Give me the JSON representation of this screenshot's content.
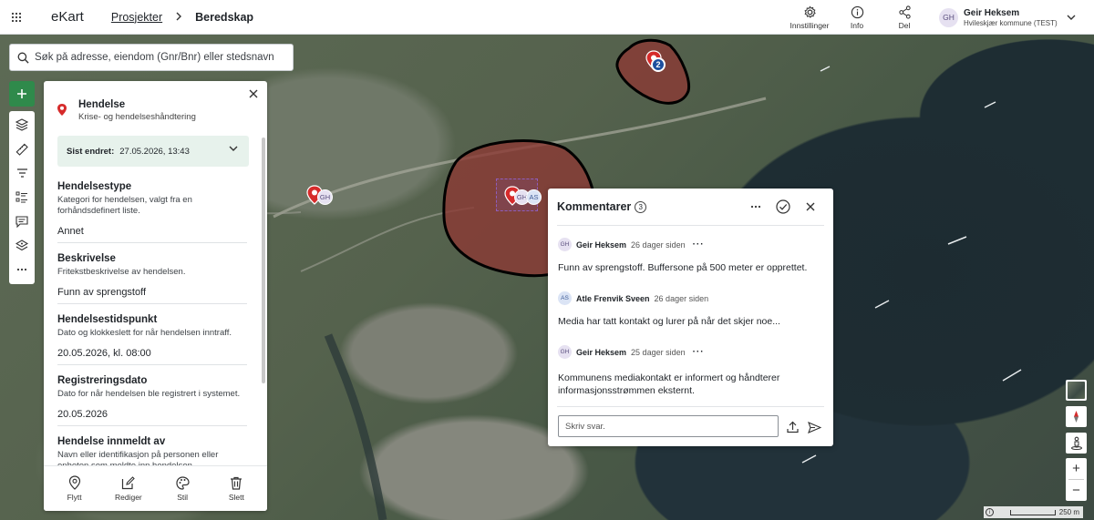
{
  "app": {
    "name": "eKart"
  },
  "breadcrumb": {
    "parent": "Prosjekter",
    "current": "Beredskap"
  },
  "header_actions": [
    {
      "label": "Innstillinger",
      "icon": "gear-icon"
    },
    {
      "label": "Info",
      "icon": "info-icon"
    },
    {
      "label": "Del",
      "icon": "share-icon"
    }
  ],
  "user": {
    "initials": "GH",
    "name": "Geir Heksem",
    "org": "Hvileskjær kommune (TEST)"
  },
  "search": {
    "placeholder": "Søk på adresse, eiendom (Gnr/Bnr) eller stedsnavn",
    "value": ""
  },
  "panel": {
    "title": "Hendelse",
    "subtitle": "Krise- og hendelseshåndtering",
    "last_changed_label": "Sist endret:",
    "last_changed_value": "27.05.2026, 13:43",
    "fields": [
      {
        "title": "Hendelsestype",
        "desc": "Kategori for hendelsen, valgt fra en forhåndsdefinert liste.",
        "value": "Annet"
      },
      {
        "title": "Beskrivelse",
        "desc": "Fritekstbeskrivelse av hendelsen.",
        "value": "Funn av sprengstoff"
      },
      {
        "title": "Hendelsestidspunkt",
        "desc": "Dato og klokkeslett for når hendelsen inntraff.",
        "value": "20.05.2026, kl. 08:00"
      },
      {
        "title": "Registreringsdato",
        "desc": "Dato for når hendelsen ble registrert i systemet.",
        "value": "20.05.2026"
      },
      {
        "title": "Hendelse innmeldt av",
        "desc": "Navn eller identifikasjon på personen eller enheten som meldte inn hendelsen",
        "value": ""
      }
    ],
    "footer_actions": [
      {
        "label": "Flytt",
        "icon": "pin-icon"
      },
      {
        "label": "Rediger",
        "icon": "edit-icon"
      },
      {
        "label": "Stil",
        "icon": "palette-icon"
      },
      {
        "label": "Slett",
        "icon": "trash-icon"
      }
    ]
  },
  "map_markers": {
    "left": {
      "initials": "GH"
    },
    "center": {
      "initials_1": "GH",
      "initials_2": "AS"
    },
    "cluster": {
      "count": "2"
    }
  },
  "comments": {
    "title": "Kommentarer",
    "count": "3",
    "items": [
      {
        "initials": "GH",
        "author": "Geir Heksem",
        "time": "26 dager siden",
        "text": "Funn av sprengstoff. Buffersone på 500 meter er opprettet."
      },
      {
        "initials": "AS",
        "author": "Atle Frenvik Sveen",
        "time": "26 dager siden",
        "text": "Media har tatt kontakt og lurer på når det skjer noe..."
      },
      {
        "initials": "GH",
        "author": "Geir Heksem",
        "time": "25 dager siden",
        "text": "Kommunens mediakontakt er informert og håndterer informasjonsstrømmen eksternt."
      }
    ],
    "reply_placeholder": "Skriv svar."
  },
  "map_controls": {
    "zoom_in": "+",
    "zoom_out": "−",
    "scale_label": "250 m",
    "info": "i"
  },
  "colors": {
    "accent_green": "#2f8a4b",
    "zone_fill": "#8b3a35",
    "marker_red": "#d62b2b",
    "cluster_blue": "#1d4f9e"
  }
}
